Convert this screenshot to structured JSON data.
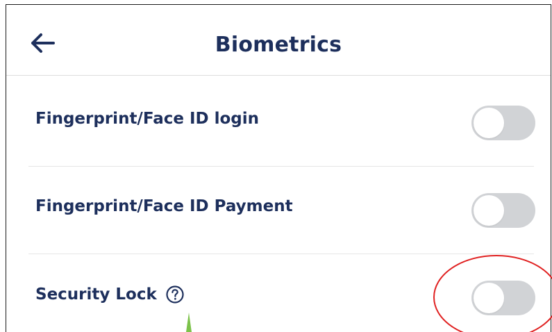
{
  "header": {
    "title": "Biometrics",
    "back_icon": "arrow-left-icon"
  },
  "settings": [
    {
      "label": "Fingerprint/Face ID login",
      "enabled": false
    },
    {
      "label": "Fingerprint/Face ID Payment",
      "enabled": false
    },
    {
      "label": "Security Lock",
      "enabled": false,
      "help_icon": "question-circle-icon"
    }
  ],
  "colors": {
    "text_primary": "#1d2f5c",
    "toggle_off": "#d1d3d6",
    "annotation": "#e02020",
    "pointer": "#7cc24a"
  }
}
